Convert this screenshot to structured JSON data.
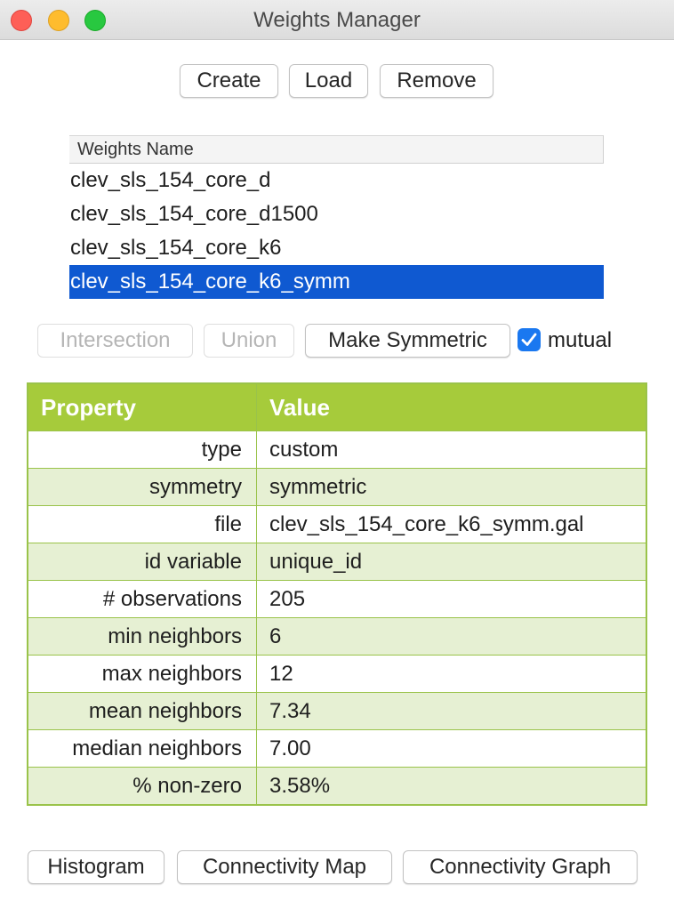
{
  "window": {
    "title": "Weights Manager"
  },
  "toolbar": {
    "create_label": "Create",
    "load_label": "Load",
    "remove_label": "Remove"
  },
  "weights_list": {
    "header": "Weights Name",
    "items": [
      "clev_sls_154_core_d",
      "clev_sls_154_core_d1500",
      "clev_sls_154_core_k6",
      "clev_sls_154_core_k6_symm"
    ],
    "selected_index": 3
  },
  "operations": {
    "intersection_label": "Intersection",
    "union_label": "Union",
    "make_symmetric_label": "Make Symmetric",
    "mutual_label": "mutual",
    "mutual_checked": true
  },
  "properties": {
    "header_property": "Property",
    "header_value": "Value",
    "rows": [
      {
        "property": "type",
        "value": "custom"
      },
      {
        "property": "symmetry",
        "value": "symmetric"
      },
      {
        "property": "file",
        "value": "clev_sls_154_core_k6_symm.gal"
      },
      {
        "property": "id variable",
        "value": "unique_id"
      },
      {
        "property": "# observations",
        "value": "205"
      },
      {
        "property": "min neighbors",
        "value": "6"
      },
      {
        "property": "max neighbors",
        "value": "12"
      },
      {
        "property": "mean neighbors",
        "value": "7.34"
      },
      {
        "property": "median neighbors",
        "value": "7.00"
      },
      {
        "property": "% non-zero",
        "value": "3.58%"
      }
    ]
  },
  "bottom_buttons": {
    "histogram_label": "Histogram",
    "connectivity_map_label": "Connectivity Map",
    "connectivity_graph_label": "Connectivity Graph"
  },
  "colors": {
    "selection": "#0f59d1",
    "table_header": "#a6cb3b",
    "table_border": "#9ac34a",
    "table_alt_row": "#e6f0d3",
    "checkbox": "#1a78f0"
  }
}
